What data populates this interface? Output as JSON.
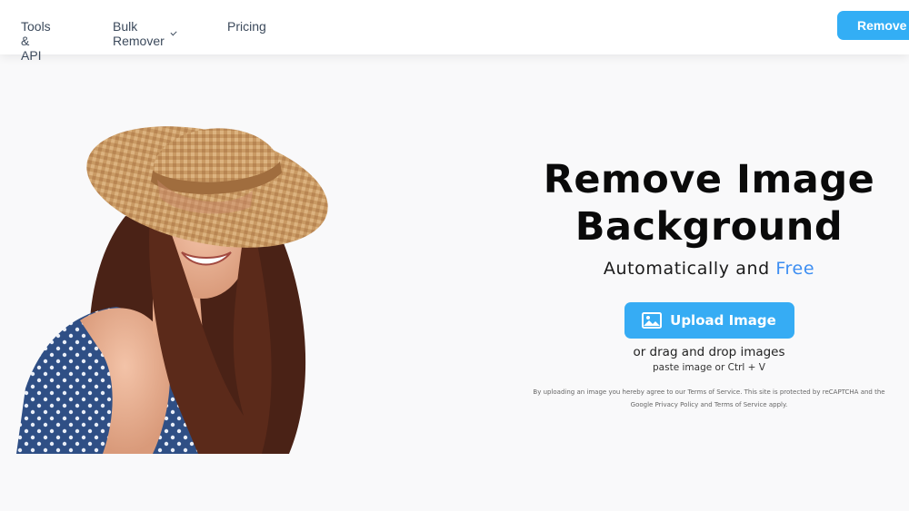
{
  "header": {
    "nav": [
      {
        "label": "Tools & API"
      },
      {
        "label": "Bulk Remover",
        "has_dropdown": true
      },
      {
        "label": "Pricing"
      }
    ],
    "cta_label": "Remove Background"
  },
  "hero": {
    "title_line1": "Remove Image",
    "title_line2": "Background",
    "subtitle_main": "Automatically and ",
    "subtitle_accent": "Free",
    "upload_label": "Upload Image",
    "drag_text": "or drag and drop images",
    "paste_text": "paste image or Ctrl + V",
    "legal": {
      "part1": "By uploading an image you hereby agree to our ",
      "terms1": "Terms of Service",
      "part2": ". This site is protected by reCAPTCHA and the Google ",
      "privacy": "Privacy Policy",
      "part3": " and ",
      "terms2": "Terms of Service",
      "part4": " apply."
    }
  },
  "colors": {
    "accent": "#36acf4",
    "free_text": "#3d8ef2",
    "background": "#f9f9fa",
    "header_bg": "#ffffff"
  },
  "icons": {
    "upload": "image-icon",
    "dropdown": "chevron-down-icon"
  }
}
